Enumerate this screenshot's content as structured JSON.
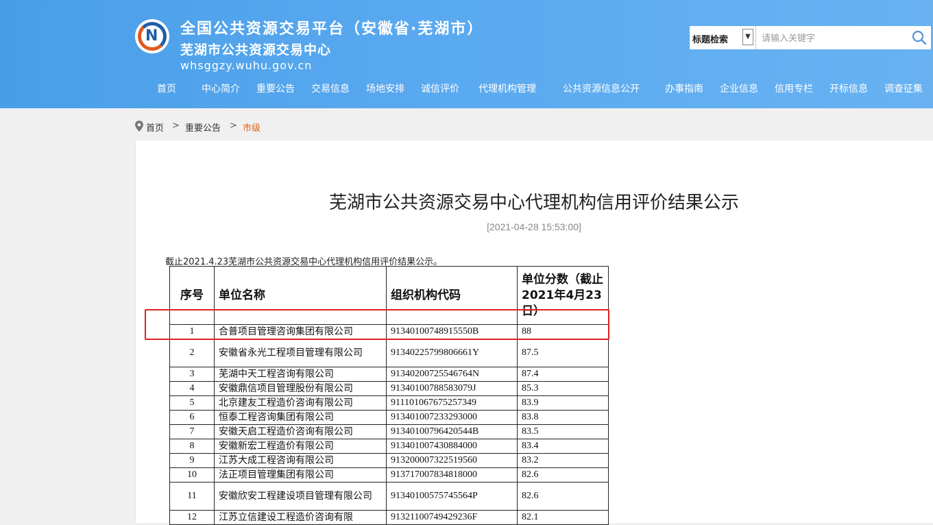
{
  "header": {
    "title_line1": "全国公共资源交易平台（安徽省·芜湖市）",
    "title_line2": "芜湖市公共资源交易中心",
    "domain": "whsggzy.wuhu.gov.cn",
    "logo_icon": "wuhu-ggzy-logo-icon"
  },
  "search": {
    "type_label": "标题检索",
    "placeholder": "请输入关键字",
    "icon": "search-icon"
  },
  "nav": [
    "首页",
    "中心简介",
    "重要公告",
    "交易信息",
    "场地安排",
    "诚信评价",
    "代理机构管理",
    "公共资源信息公开",
    "办事指南",
    "企业信息",
    "信用专栏",
    "开标信息",
    "调查征集"
  ],
  "breadcrumb": [
    "首页",
    ">",
    "重要公告",
    ">",
    "市级"
  ],
  "article": {
    "title": "芜湖市公共资源交易中心代理机构信用评价结果公示",
    "date": "[2021-04-28 15:53:00]",
    "intro": "截止2021.4.23芜湖市公共资源交易中心代理机构信用评价结果公示。"
  },
  "table": {
    "headers": [
      "序号",
      "单位名称",
      "组织机构代码",
      "单位分数（截止2021年4月23日）"
    ],
    "rows": [
      [
        "1",
        "合普项目管理咨询集团有限公司",
        "91340100748915550B",
        "88"
      ],
      [
        "2",
        "安徽省永光工程项目管理有限公司",
        "91340225799806661Y",
        "87.5"
      ],
      [
        "3",
        "芜湖中天工程咨询有限公司",
        "91340200725546764N",
        "87.4"
      ],
      [
        "4",
        "安徽鼎信项目管理股份有限公司",
        "91340100788583079J",
        "85.3"
      ],
      [
        "5",
        "北京建友工程造价咨询有限公司",
        "911101067675257349",
        "83.9"
      ],
      [
        "6",
        "恒泰工程咨询集团有限公司",
        "913401007233293000",
        "83.8"
      ],
      [
        "7",
        "安徽天启工程造价咨询有限公司",
        "91340100796420544B",
        "83.5"
      ],
      [
        "8",
        "安徽新宏工程造价有限公司",
        "913401007430884000",
        "83.4"
      ],
      [
        "9",
        "江苏大成工程咨询有限公司",
        "913200007322519560",
        "83.2"
      ],
      [
        "10",
        "法正项目管理集团有限公司",
        "913717007834818000",
        "82.6"
      ],
      [
        "11",
        "安徽欣安工程建设项目管理有限公司",
        "91340100575745564P",
        "82.6"
      ],
      [
        "12",
        "江苏立信建设工程造价咨询有限",
        "91321100749429236F",
        "82.1"
      ]
    ]
  },
  "colors": {
    "header_bg": "#5aaaf0",
    "breadcrumb_current": "#e0651a",
    "highlight_box": "#e02020"
  }
}
